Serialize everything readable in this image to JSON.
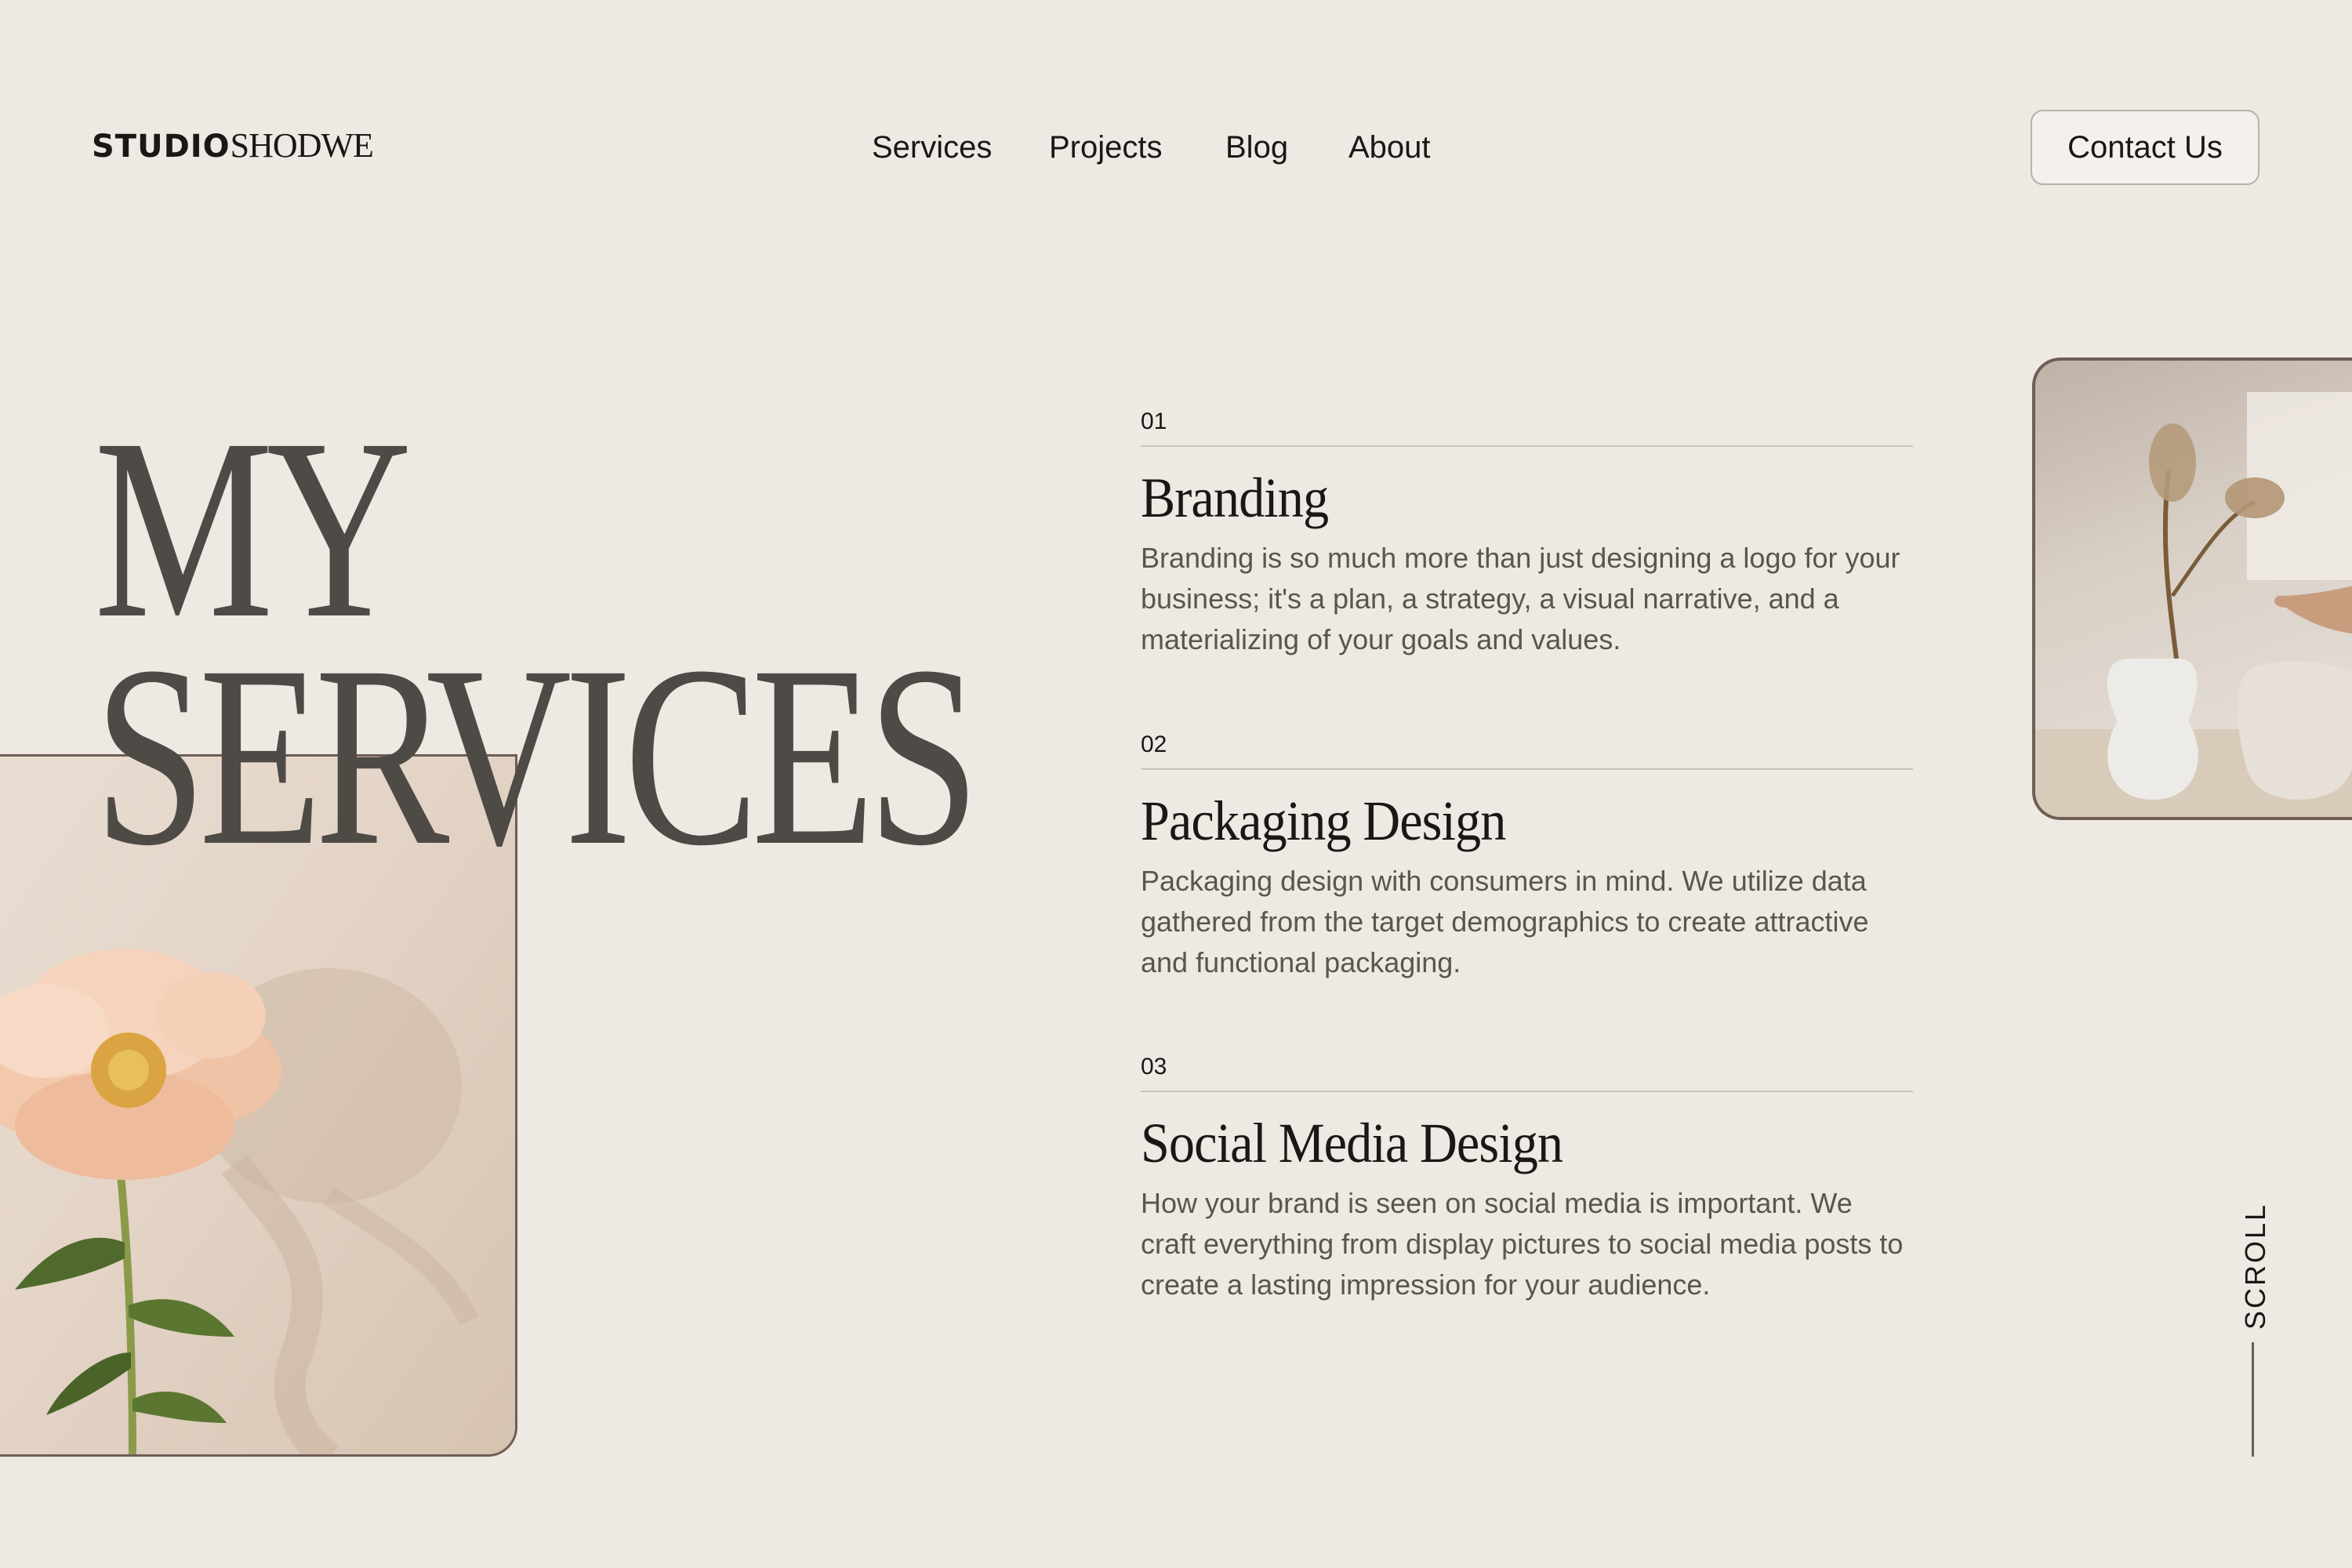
{
  "brand": {
    "bold": "STUDIO",
    "thin": "SHODWE"
  },
  "nav": {
    "items": [
      {
        "label": "Services"
      },
      {
        "label": "Projects"
      },
      {
        "label": "Blog"
      },
      {
        "label": "About"
      }
    ]
  },
  "header": {
    "contact_label": "Contact Us"
  },
  "hero": {
    "line1": "MY",
    "line2": "SERVICES"
  },
  "services": [
    {
      "num": "01",
      "title": "Branding",
      "description": "Branding is so much more than just designing a logo for your business; it's a plan, a strategy, a visual narrative, and a materializing of your goals and values."
    },
    {
      "num": "02",
      "title": "Packaging Design",
      "description": "Packaging design with consumers in mind. We utilize data gathered from the target demographics to create attractive and functional packaging."
    },
    {
      "num": "03",
      "title": "Social Media Design",
      "description": "How your brand is seen on social media is important. We craft everything from display pictures to social media posts to create a lasting impression for your audience."
    }
  ],
  "scroll_label": "SCROLL",
  "colors": {
    "background": "#efe9e3",
    "heading": "#4e4a46",
    "frame": "#6e5e56",
    "body_text": "#5a5550"
  },
  "images": {
    "left": "peony-flower-photo",
    "right": "vase-dried-flowers-photo"
  }
}
